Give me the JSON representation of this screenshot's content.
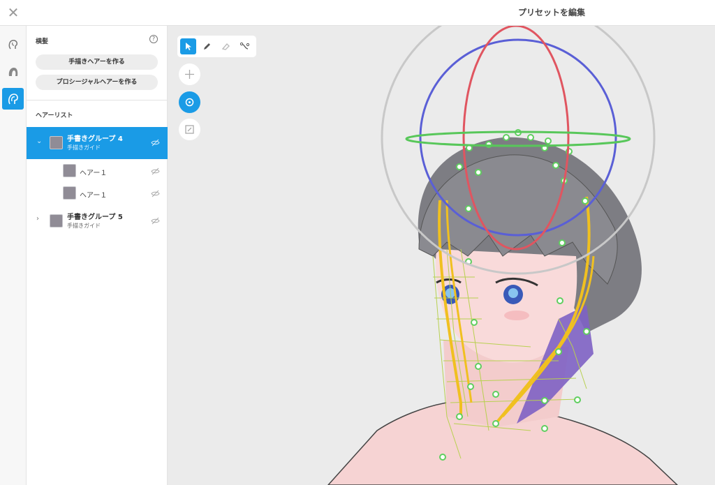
{
  "window": {
    "close_glyph": "✕",
    "title": "プリセットを編集"
  },
  "iconbar": {
    "items": [
      {
        "icon": "head-icon",
        "active": false
      },
      {
        "icon": "hair-silhouette-icon",
        "active": false
      },
      {
        "icon": "hair-edit-icon",
        "active": true
      }
    ]
  },
  "panel": {
    "section_title": "横髪",
    "help_glyph": "?",
    "buttons": {
      "hand_drawn": "手描きヘアーを作る",
      "procedural": "プロシージャルヘアーを作る"
    },
    "list_title": "ヘアーリスト",
    "groups": [
      {
        "name": "手書きグループ 4",
        "subtitle": "手描きガイド",
        "expanded": true,
        "selected": true,
        "children": [
          {
            "name": "ヘアー１"
          },
          {
            "name": "ヘアー１"
          }
        ]
      },
      {
        "name": "手書きグループ 5",
        "subtitle": "手描きガイド",
        "expanded": false,
        "selected": false
      }
    ]
  },
  "viewport": {
    "tools": [
      "select-tool",
      "pen-tool",
      "eraser-tool",
      "curve-tool"
    ],
    "active_tool": "select-tool",
    "transform_buttons": [
      "move",
      "rotate",
      "scale"
    ],
    "active_transform": "rotate"
  },
  "colors": {
    "accent": "#1a9be6",
    "gizmo_x": "#5a5fd6",
    "gizmo_y": "#e05560",
    "gizmo_z": "#58c75a",
    "gizmo_outer": "#c8c8c8",
    "guide_curve": "#f0c020",
    "guide_mesh": "#b8d050",
    "hair": "#8a8a90",
    "skin": "#f6d3d3"
  }
}
